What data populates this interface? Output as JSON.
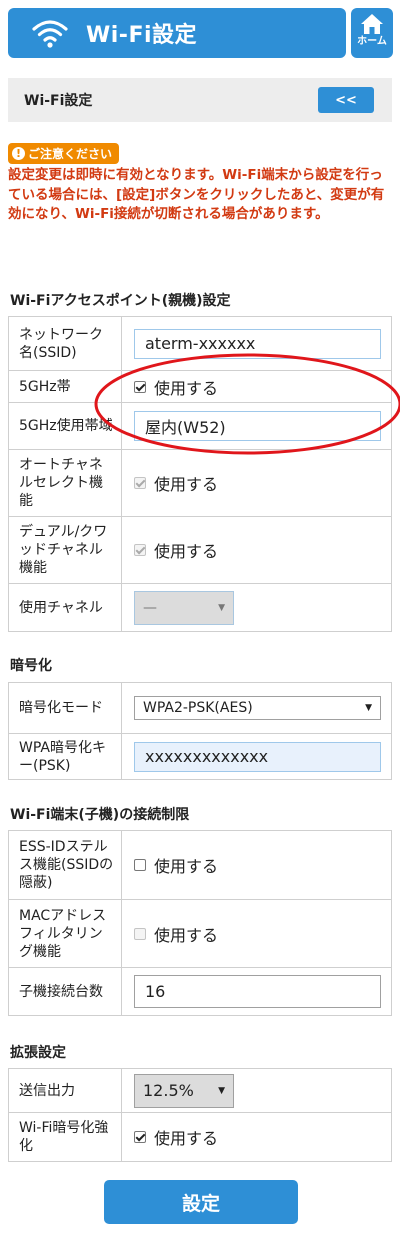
{
  "header": {
    "title": "Wi-Fi設定",
    "home_label": "ホーム"
  },
  "section": {
    "title": "Wi-Fi設定",
    "back_label": "<<"
  },
  "caution": {
    "badge": "ご注意ください",
    "text": "設定変更は即時に有効となります。Wi-Fi端末から設定を行っている場合には、[設定]ボタンをクリックしたあと、変更が有効になり、Wi-Fi接続が切断される場合があります。"
  },
  "ap": {
    "title": "Wi-Fiアクセスポイント(親機)設定",
    "network_name_label": "ネットワーク名(SSID)",
    "network_name_value": "aterm-xxxxxx",
    "band5_label": "5GHz帯",
    "band5_text": "使用する",
    "band5_checked": true,
    "band5_usage_label": "5GHz使用帯域",
    "band5_usage_value": "屋内(W52)",
    "auto_channel_label": "オートチャネルセレクト機能",
    "auto_channel_text": "使用する",
    "dual_channel_label": "デュアル/クワッドチャネル機能",
    "dual_channel_text": "使用する",
    "channel_label": "使用チャネル",
    "channel_value": "—"
  },
  "encryption": {
    "title": "暗号化",
    "mode_label": "暗号化モード",
    "mode_value": "WPA2-PSK(AES)",
    "key_label": "WPA暗号化キー(PSK)",
    "key_value": "xxxxxxxxxxxxx"
  },
  "client": {
    "title": "Wi-Fi端末(子機)の接続制限",
    "essid_stealth_label": "ESS-IDステルス機能(SSIDの隠蔽)",
    "essid_stealth_text": "使用する",
    "mac_filter_label": "MACアドレスフィルタリング機能",
    "mac_filter_text": "使用する",
    "max_clients_label": "子機接続台数",
    "max_clients_value": "16"
  },
  "extended": {
    "title": "拡張設定",
    "tx_power_label": "送信出力",
    "tx_power_value": "12.5%",
    "wifi_enc_label": "Wi-Fi暗号化強化",
    "wifi_enc_text": "使用する"
  },
  "submit_label": "設定",
  "colors": {
    "primary": "#2e8fd6",
    "caution": "#d23a12",
    "badge": "#f08a00",
    "highlight": "#e0161b"
  }
}
